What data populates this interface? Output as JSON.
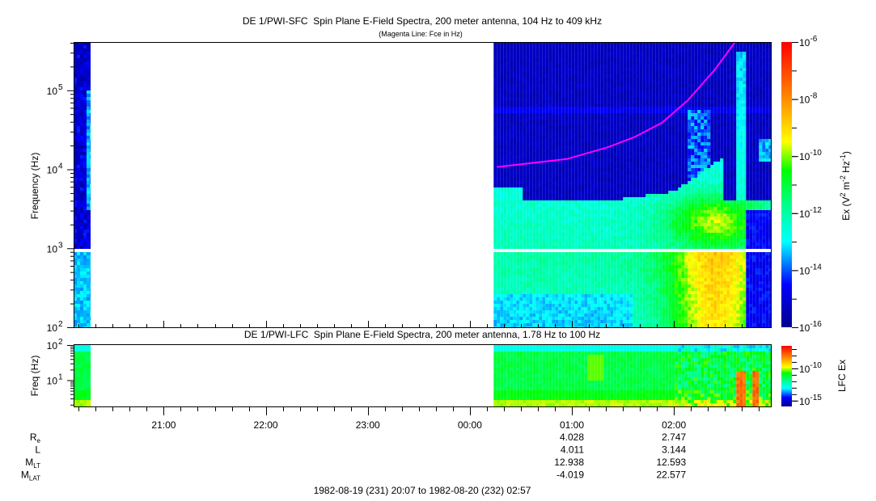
{
  "chart_data": [
    {
      "type": "heatmap",
      "title": "DE 1/PWI-SFC  Spin Plane E-Field Spectra, 200 meter antenna, 104 Hz to 409 kHz",
      "subtitle": "(Magenta Line: Fce in Hz)",
      "ylabel": "Frequency (Hz)",
      "yscale": "log",
      "ylim": [
        100,
        409000
      ],
      "yticks": [
        {
          "base": "10",
          "exp": "2"
        },
        {
          "base": "10",
          "exp": "3"
        },
        {
          "base": "10",
          "exp": "4"
        },
        {
          "base": "10",
          "exp": "5"
        }
      ],
      "colorbar": {
        "label_main": "Ex (V",
        "label_parts": [
          "2",
          " m",
          "-2",
          " Hz",
          "-1",
          ")"
        ],
        "range_log10": [
          -16,
          -6
        ],
        "ticks": [
          {
            "base": "10",
            "exp": "-6"
          },
          {
            "base": "10",
            "exp": "-8"
          },
          {
            "base": "10",
            "exp": "-10"
          },
          {
            "base": "10",
            "exp": "-12"
          },
          {
            "base": "10",
            "exp": "-14"
          },
          {
            "base": "10",
            "exp": "-16"
          }
        ]
      },
      "data_gaps_hhmm": [
        "20:17-00:14"
      ],
      "overlay_fce": {
        "color": "#ff00ff",
        "t_min": [
          249,
          290,
          314,
          330,
          346,
          361,
          377,
          389
        ],
        "hz": [
          10700,
          13500,
          19000,
          25700,
          38900,
          74100,
          182000,
          417000
        ]
      }
    },
    {
      "type": "heatmap",
      "title": "DE 1/PWI-LFC  Spin Plane E-Field Spectra, 200 meter antenna, 1.78 Hz to 100 Hz",
      "ylabel": "Freq (Hz)",
      "yscale": "log",
      "ylim": [
        1.78,
        100
      ],
      "yticks": [
        {
          "base": "10",
          "exp": "1"
        },
        {
          "base": "10",
          "exp": "2"
        }
      ],
      "colorbar": {
        "label": "LFC Ex",
        "range_log10": [
          -15.9,
          -6.5
        ],
        "ticks": [
          {
            "base": "10",
            "exp": "-10"
          },
          {
            "base": "10",
            "exp": "-15"
          }
        ]
      }
    }
  ],
  "time_axis": {
    "start_min_label": "20:07",
    "span_min": 410,
    "ticks": [
      {
        "label": "21:00",
        "t_min": 53
      },
      {
        "label": "22:00",
        "t_min": 113
      },
      {
        "label": "23:00",
        "t_min": 173
      },
      {
        "label": "00:00",
        "t_min": 233
      },
      {
        "label": "01:00",
        "t_min": 293
      },
      {
        "label": "02:00",
        "t_min": 353
      }
    ],
    "range_label": "1982-08-19 (231) 20:07 to 1982-08-20 (232) 02:57"
  },
  "ephemeris": [
    {
      "label": "R",
      "sub": "e",
      "values": [
        "4.028",
        "2.747"
      ]
    },
    {
      "label": "L",
      "sub": "",
      "values": [
        "4.011",
        "3.144"
      ]
    },
    {
      "label": "M",
      "sub": "LT",
      "values": [
        "12.938",
        "12.593"
      ]
    },
    {
      "label": "M",
      "sub": "LAT",
      "values": [
        "-4.019",
        "22.577"
      ]
    }
  ],
  "colors": {
    "fce_line": "#ff00ff",
    "background": "#ffffff"
  }
}
